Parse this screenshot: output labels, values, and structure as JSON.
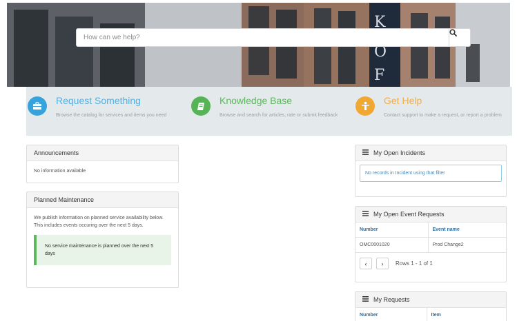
{
  "search": {
    "placeholder": "How can we help?",
    "icon": "search-icon"
  },
  "quick_links": [
    {
      "title": "Request Something",
      "description": "Browse the catalog for services and items you need",
      "icon": "briefcase-icon",
      "color": "#37a3dc",
      "title_color": "#53b0e0"
    },
    {
      "title": "Knowledge Base",
      "description": "Browse and search for articles, rate or submit feedback",
      "icon": "book-icon",
      "color": "#56b356",
      "title_color": "#5cb85c"
    },
    {
      "title": "Get Help",
      "description": "Contact support to make a request, or report a problem",
      "icon": "help-icon",
      "color": "#f0a832",
      "title_color": "#f0ad4e"
    }
  ],
  "announcements": {
    "title": "Announcements",
    "body": "No information available"
  },
  "maintenance": {
    "title": "Planned Maintenance",
    "body": "We publish information on planned service availability below. This includes events occuring over the next 5 days.",
    "notice": "No service maintenance is planned over the next 5 days"
  },
  "incidents": {
    "title": "My Open Incidents",
    "empty": "No records in Incident using that filter"
  },
  "event_requests": {
    "title": "My Open Event Requests",
    "columns": [
      "Number",
      "Event name"
    ],
    "rows": [
      [
        "OMC0001020",
        "Prod Change2"
      ]
    ],
    "pager": {
      "prev": "‹",
      "next": "›",
      "rows_label": "Rows 1 - 1 of 1"
    }
  },
  "my_requests": {
    "title": "My Requests",
    "columns": [
      "Number",
      "Item"
    ]
  },
  "colors": {
    "accent": "#2a6fa5",
    "band": "#e4e9ec",
    "success": "#5cb85c"
  }
}
